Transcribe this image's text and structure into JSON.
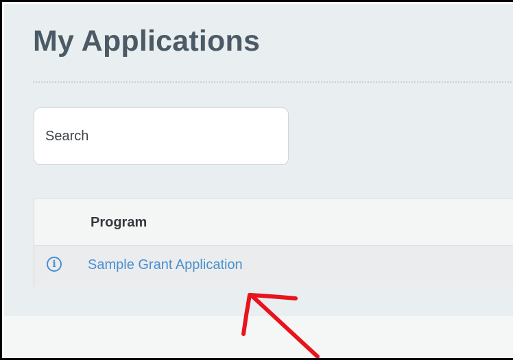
{
  "page": {
    "title": "My Applications"
  },
  "search": {
    "placeholder": "Search"
  },
  "table": {
    "columns": [
      "Program"
    ],
    "rows": [
      {
        "info_icon": "info-icon",
        "program": "Sample Grant Application"
      }
    ]
  },
  "annotation": {
    "icon": "red-arrow",
    "color": "#e8141c"
  },
  "colors": {
    "panel_bg": "#e9eef0",
    "title": "#4b5a64",
    "link": "#4a8fd0"
  }
}
